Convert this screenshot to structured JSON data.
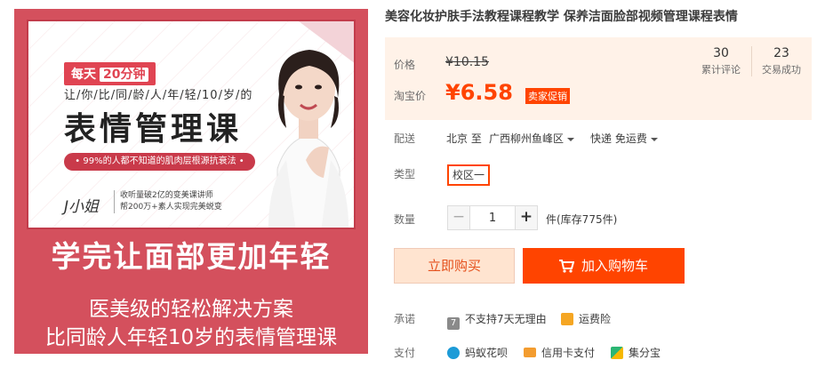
{
  "image": {
    "daily_badge": "每天",
    "daily_badge_time": "20分钟",
    "tagline": "让/你/比/同/龄/人/年/轻/10/岁/的",
    "course_title": "表情管理课",
    "secret_bar": "• 99%的人都不知道的肌肉层根源抗衰法 •",
    "teacher_name": "J小姐",
    "teacher_desc_1": "收听量破2亿的变美课讲师",
    "teacher_desc_2": "帮200万+素人实现完美蜕变",
    "banner_main": "学完让面部更加年轻",
    "banner_sub_1": "医美级的轻松解决方案",
    "banner_sub_2": "比同龄人年轻10岁的表情管理课",
    "colors": {
      "background": "#d4505d",
      "frame_border": "#c23c4b"
    }
  },
  "product": {
    "title": "美容化妆护肤手法教程课程教学 保养洁面脸部视频管理课程表情"
  },
  "price": {
    "label": "价格",
    "original": "¥10.15",
    "taobao_label": "淘宝价",
    "promo": "¥6.58",
    "promo_badge": "卖家促销",
    "accent_color": "#ff4400"
  },
  "stats": {
    "reviews_count": "30",
    "reviews_label": "累计评论",
    "deals_count": "23",
    "deals_label": "交易成功"
  },
  "shipping": {
    "label": "配送",
    "origin": "北京 至",
    "destination": "广西柳州鱼峰区",
    "fee": "快递 免运费"
  },
  "sku": {
    "label": "类型",
    "option": "校区一"
  },
  "quantity": {
    "label": "数量",
    "minus": "−",
    "value": "1",
    "plus": "+",
    "stock": "件(库存775件)"
  },
  "actions": {
    "buy_now": "立即购买",
    "add_cart": "加入购物车"
  },
  "guarantee": {
    "label": "承诺",
    "items": [
      {
        "icon": "no-return-icon",
        "text": "不支持7天无理由"
      },
      {
        "icon": "shipping-insurance-icon",
        "text": "运费险"
      }
    ]
  },
  "payment": {
    "label": "支付",
    "items": [
      {
        "icon": "huabei-icon",
        "text": "蚂蚁花呗"
      },
      {
        "icon": "credit-card-icon",
        "text": "信用卡支付"
      },
      {
        "icon": "jifenbao-icon",
        "text": "集分宝"
      }
    ]
  }
}
